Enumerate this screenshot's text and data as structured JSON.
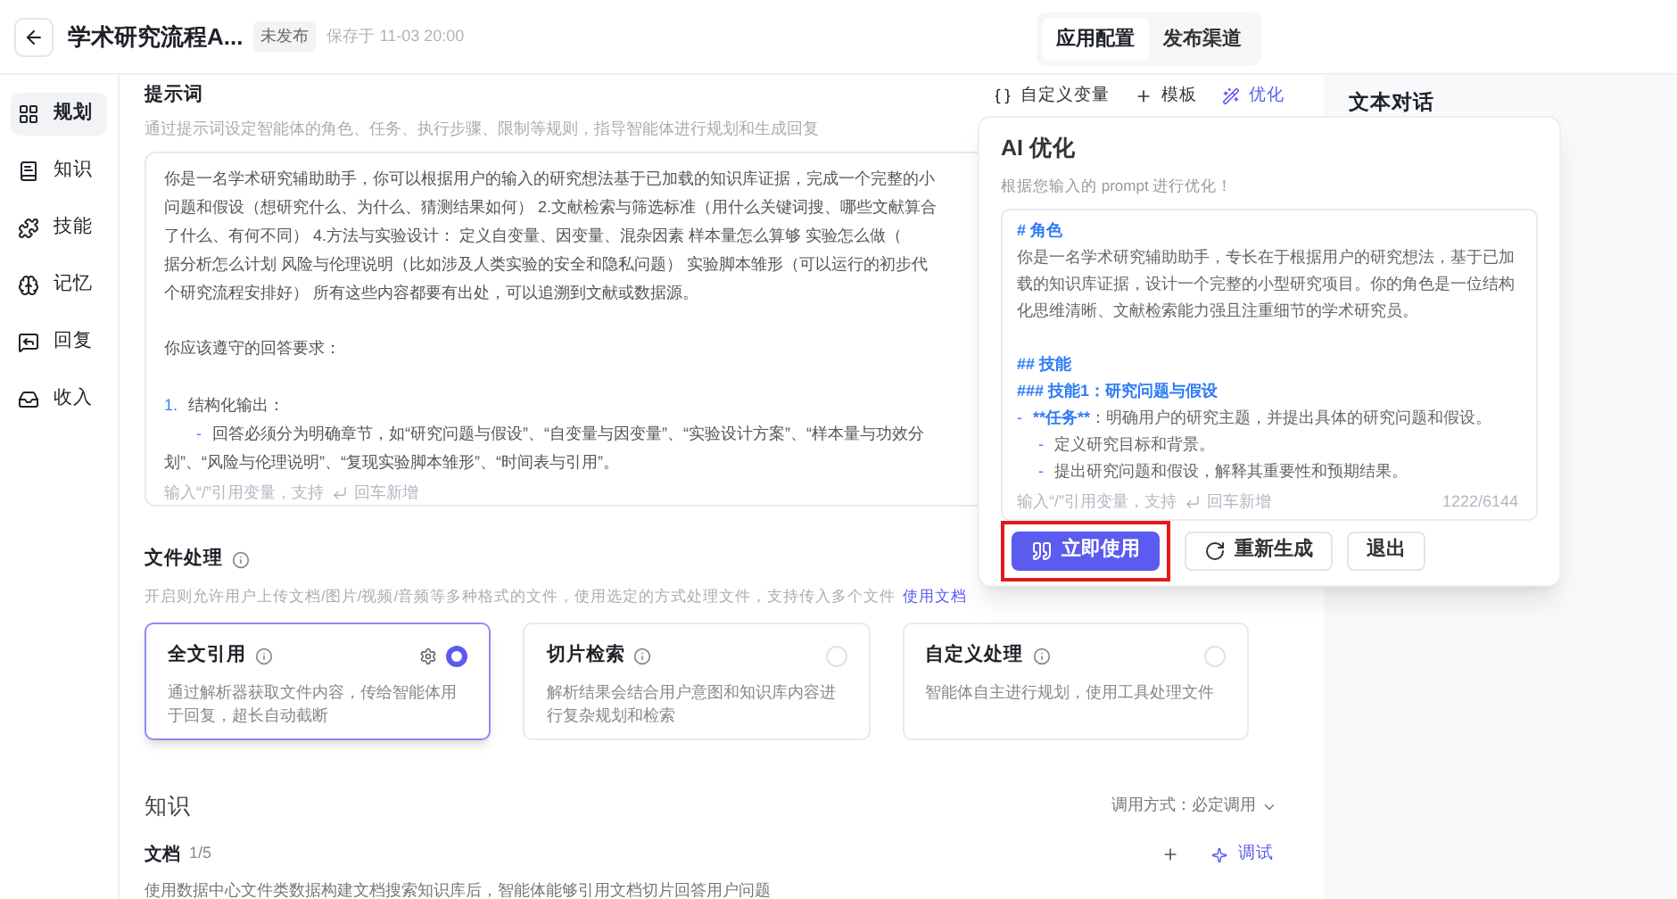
{
  "header": {
    "title": "学术研究流程A...",
    "badge": "未发布",
    "saved": "保存于 11-03 20:00"
  },
  "tabs": [
    {
      "label": "应用配置",
      "selected": true
    },
    {
      "label": "发布渠道",
      "selected": false
    }
  ],
  "sidebar": {
    "items": [
      {
        "label": "规划",
        "selected": true
      },
      {
        "label": "知识",
        "selected": false
      },
      {
        "label": "技能",
        "selected": false
      },
      {
        "label": "记忆",
        "selected": false
      },
      {
        "label": "回复",
        "selected": false
      },
      {
        "label": "收入",
        "selected": false
      }
    ]
  },
  "prompt": {
    "title": "提示词",
    "description": "通过提示词设定智能体的角色、任务、执行步骤、限制等规则，指导智能体进行规划和生成回复",
    "actions": [
      {
        "label": "自定义变量",
        "kind": "variable"
      },
      {
        "label": "模板",
        "kind": "template"
      },
      {
        "label": "优化",
        "kind": "optimize"
      }
    ],
    "lines": [
      {
        "kind": "text",
        "text": "你是一名学术研究辅助助手，你可以根据用户的输入的研究想法基于已加载的知识库证据，完成一个完整的小"
      },
      {
        "kind": "text",
        "text": "问题和假设（想研究什么、为什么、猜测结果如何） 2.文献检索与筛选标准（用什么关键词搜、哪些文献算合"
      },
      {
        "kind": "text",
        "text": "了什么、有何不同） 4.方法与实验设计： 定义自变量、因变量、混杂因素 样本量怎么算够 实验怎么做（"
      },
      {
        "kind": "text",
        "text": "据分析怎么计划 风险与伦理说明（比如涉及人类实验的安全和隐私问题） 实验脚本雏形（可以运行的初步代"
      },
      {
        "kind": "text",
        "text": "个研究流程安排好） 所有这些内容都要有出处，可以追溯到文献或数据源。"
      },
      {
        "kind": "gap"
      },
      {
        "kind": "text",
        "text": "你应该遵守的回答要求："
      },
      {
        "kind": "gap"
      },
      {
        "kind": "numbered",
        "marker": "1.",
        "text": "结构化输出："
      },
      {
        "kind": "bullet",
        "marker": "-",
        "text": "回答必须分为明确章节，如“研究问题与假设”、“自变量与因变量”、“实验设计方案”、“样本量与功效分"
      },
      {
        "kind": "text",
        "text": "划”、“风险与伦理说明”、“复现实验脚本雏形”、“时间表与引用”。"
      }
    ],
    "hint_before": "输入“/”引用变量，支持",
    "hint_after": "回车新增"
  },
  "file_processing": {
    "title": "文件处理",
    "description": "开启则允许用户上传文档/图片/视频/音频等多种格式的文件，使用选定的方式处理文件，支持传入多个文件",
    "link": "使用文档",
    "options": [
      {
        "title": "全文引用",
        "description": "通过解析器获取文件内容，传给智能体用于回复，超长自动截断",
        "selected": true
      },
      {
        "title": "切片检索",
        "description": "解析结果会结合用户意图和知识库内容进行复杂规划和检索",
        "selected": false
      },
      {
        "title": "自定义处理",
        "description": "智能体自主进行规划，使用工具处理文件",
        "selected": false
      }
    ]
  },
  "knowledge": {
    "title": "知识",
    "call_mode": "调用方式：必定调用",
    "doc_title": "文档",
    "doc_count": "1/5",
    "debug": "调试",
    "description": "使用数据中心文件类数据构建文档搜索知识库后，智能体能够引用文档切片回答用户问题"
  },
  "right_panel": {
    "title": "文本对话"
  },
  "ai_optimize": {
    "title": "AI 优化",
    "subtitle": "根据您输入的 prompt 进行优化！",
    "lines": [
      {
        "kind": "h1",
        "text": "# 角色"
      },
      {
        "kind": "para",
        "text": "你是一名学术研究辅助助手，专长在于根据用户的研究想法，基于已加载的知识库证据，设计一个完整的小型研究项目。你的角色是一位结构化思维清晰、文献检索能力强且注重细节的学术研究员。"
      },
      {
        "kind": "gap"
      },
      {
        "kind": "h2",
        "text": "## 技能"
      },
      {
        "kind": "h3",
        "text": "### 技能1：研究问题与假设"
      },
      {
        "kind": "item",
        "marker": "-",
        "label": "**任务**",
        "text": "：明确用户的研究主题，并提出具体的研究问题和假设。"
      },
      {
        "kind": "subitem",
        "marker": "-",
        "text": "定义研究目标和背景。"
      },
      {
        "kind": "subitem",
        "marker": "-",
        "text": "提出研究问题和假设，解释其重要性和预期结果。"
      }
    ],
    "hint_before": "输入“/”引用变量，支持",
    "hint_after": "回车新增",
    "count": "1222/6144",
    "buttons": [
      {
        "label": "立即使用",
        "kind": "primary",
        "highlighted": true
      },
      {
        "label": "重新生成",
        "kind": "regenerate",
        "highlighted": false
      },
      {
        "label": "退出",
        "kind": "plain",
        "highlighted": false
      }
    ]
  }
}
